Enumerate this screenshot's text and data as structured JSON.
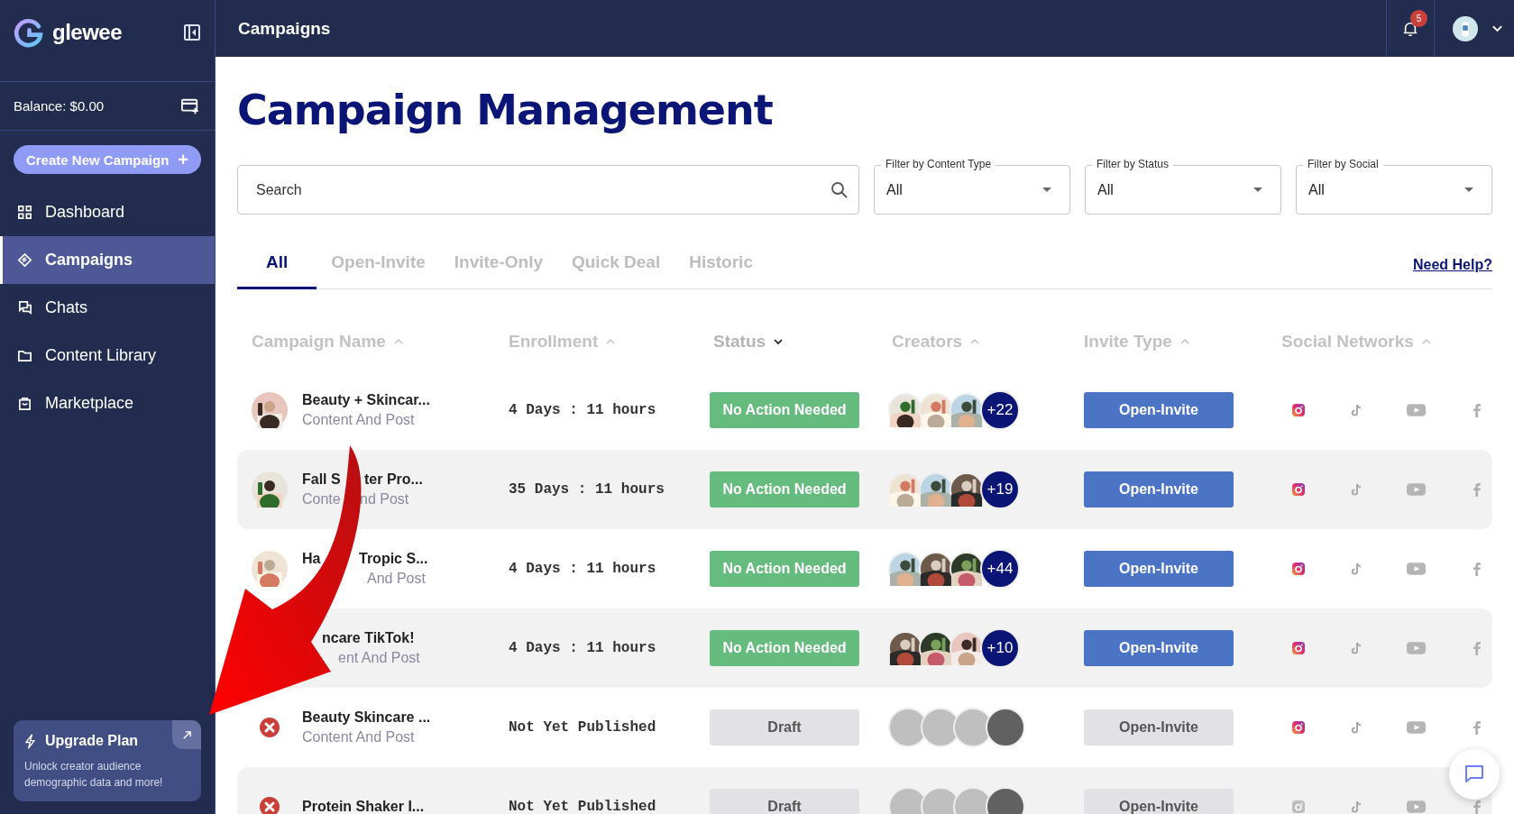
{
  "sidebar": {
    "brand": "glewee",
    "balance": "Balance: $0.00",
    "create_button": "Create New Campaign",
    "create_icon": "+",
    "items": [
      {
        "label": "Dashboard",
        "selected": false
      },
      {
        "label": "Campaigns",
        "selected": true
      },
      {
        "label": "Chats",
        "selected": false
      },
      {
        "label": "Content Library",
        "selected": false
      },
      {
        "label": "Marketplace",
        "selected": false
      }
    ],
    "upgrade": {
      "title": "Upgrade Plan",
      "text": "Unlock creator audience demographic data and more!"
    }
  },
  "topbar": {
    "title": "Campaigns",
    "notifications": "5"
  },
  "page": {
    "title": "Campaign Management",
    "search": {
      "placeholder": "Search"
    },
    "filters": [
      {
        "label": "Filter by Content Type",
        "value": "All"
      },
      {
        "label": "Filter by Status",
        "value": "All"
      },
      {
        "label": "Filter by Social",
        "value": "All"
      }
    ],
    "tabs": [
      {
        "label": "All",
        "selected": true
      },
      {
        "label": "Open-Invite",
        "selected": false
      },
      {
        "label": "Invite-Only",
        "selected": false
      },
      {
        "label": "Quick Deal",
        "selected": false
      },
      {
        "label": "Historic",
        "selected": false
      }
    ],
    "help_link": "Need Help?",
    "columns": [
      {
        "label": "Campaign Name",
        "selected": false
      },
      {
        "label": "Enrollment",
        "selected": false
      },
      {
        "label": "Status",
        "selected": true
      },
      {
        "label": "Creators",
        "selected": false
      },
      {
        "label": "Invite Type",
        "selected": false
      },
      {
        "label": "Social Networks",
        "selected": false
      }
    ],
    "rows": [
      {
        "name": [
          "Beauty + Skincar..."
        ],
        "type": [
          "Content And Post"
        ],
        "enrollment": "4 Days : 11 hours",
        "status": "No Action Needed",
        "kind": "active",
        "creators": "+22",
        "invite": "Open-Invite",
        "instagram_on": true
      },
      {
        "name": [
          "Fall S",
          "ter Pro..."
        ],
        "type": [
          "Conte",
          "nd Post"
        ],
        "enrollment": "35 Days : 11 hours",
        "status": "No Action Needed",
        "kind": "active",
        "creators": "+19",
        "invite": "Open-Invite",
        "instagram_on": true
      },
      {
        "name": [
          "Ha",
          "Tropic S..."
        ],
        "type": [
          "And Post"
        ],
        "enrollment": "4 Days : 11 hours",
        "status": "No Action Needed",
        "kind": "active",
        "creators": "+44",
        "invite": "Open-Invite",
        "instagram_on": true
      },
      {
        "name": [
          "ncare TikTok!"
        ],
        "type": [
          "ent And Post"
        ],
        "enrollment": "4 Days : 11 hours",
        "status": "No Action Needed",
        "kind": "active",
        "creators": "+10",
        "invite": "Open-Invite",
        "instagram_on": true
      },
      {
        "name": [
          "Beauty Skincare ..."
        ],
        "type": [
          "Content And Post"
        ],
        "enrollment": "Not Yet Published",
        "status": "Draft",
        "kind": "draft",
        "invite": "Open-Invite",
        "instagram_on": true
      },
      {
        "name": [
          "Protein Shaker I..."
        ],
        "enrollment": "Not Yet Published",
        "status": "Draft",
        "kind": "draft",
        "invite": "Open-Invite",
        "instagram_on": false
      }
    ]
  }
}
